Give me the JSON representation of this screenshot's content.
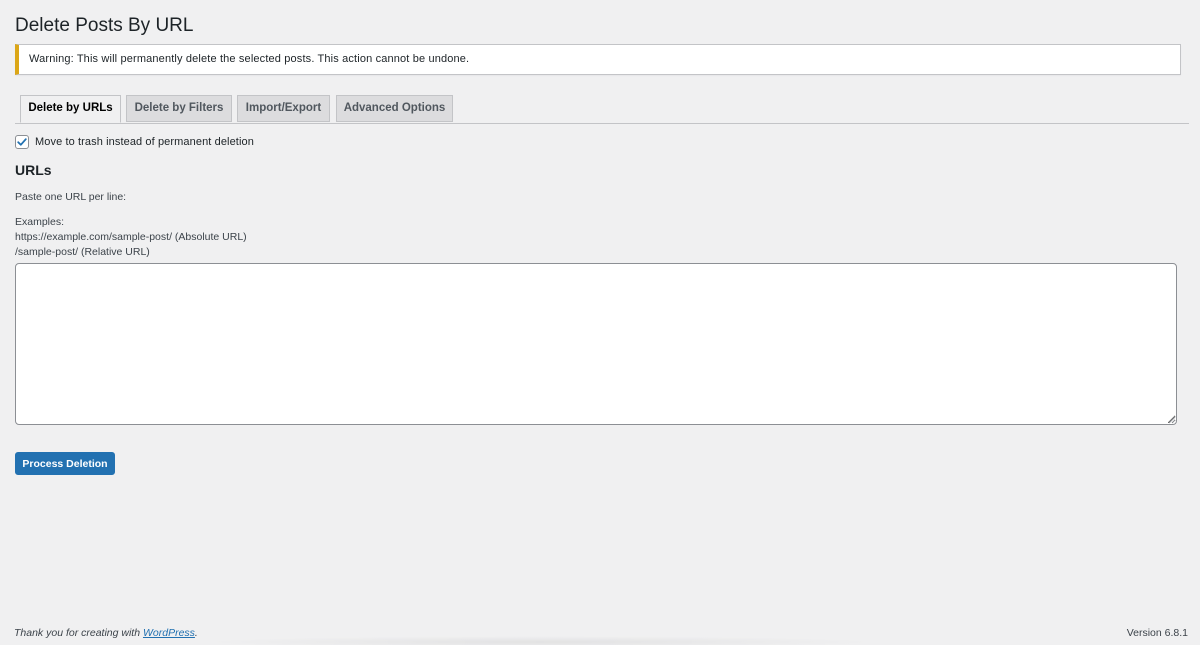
{
  "page": {
    "title": "Delete Posts By URL"
  },
  "notice": {
    "text": "Warning: This will permanently delete the selected posts. This action cannot be undone.",
    "accent_color": "#dba617"
  },
  "tabs": [
    {
      "label": "Delete by URLs",
      "active": true
    },
    {
      "label": "Delete by Filters",
      "active": false
    },
    {
      "label": "Import/Export",
      "active": false
    },
    {
      "label": "Advanced Options",
      "active": false
    }
  ],
  "trash_option": {
    "label": "Move to trash instead of permanent deletion",
    "checked": true
  },
  "urls_section": {
    "title": "URLs",
    "instruction": "Paste one URL per line:",
    "examples_label": "Examples:",
    "example_absolute": "https://example.com/sample-post/ (Absolute URL)",
    "example_relative": "/sample-post/ (Relative URL)",
    "textarea_value": ""
  },
  "actions": {
    "process_label": "Process Deletion",
    "primary_color": "#2271b1"
  },
  "footer": {
    "thanks_prefix": "Thank you for creating with ",
    "thanks_link": "WordPress",
    "thanks_suffix": ".",
    "version": "Version 6.8.1"
  }
}
